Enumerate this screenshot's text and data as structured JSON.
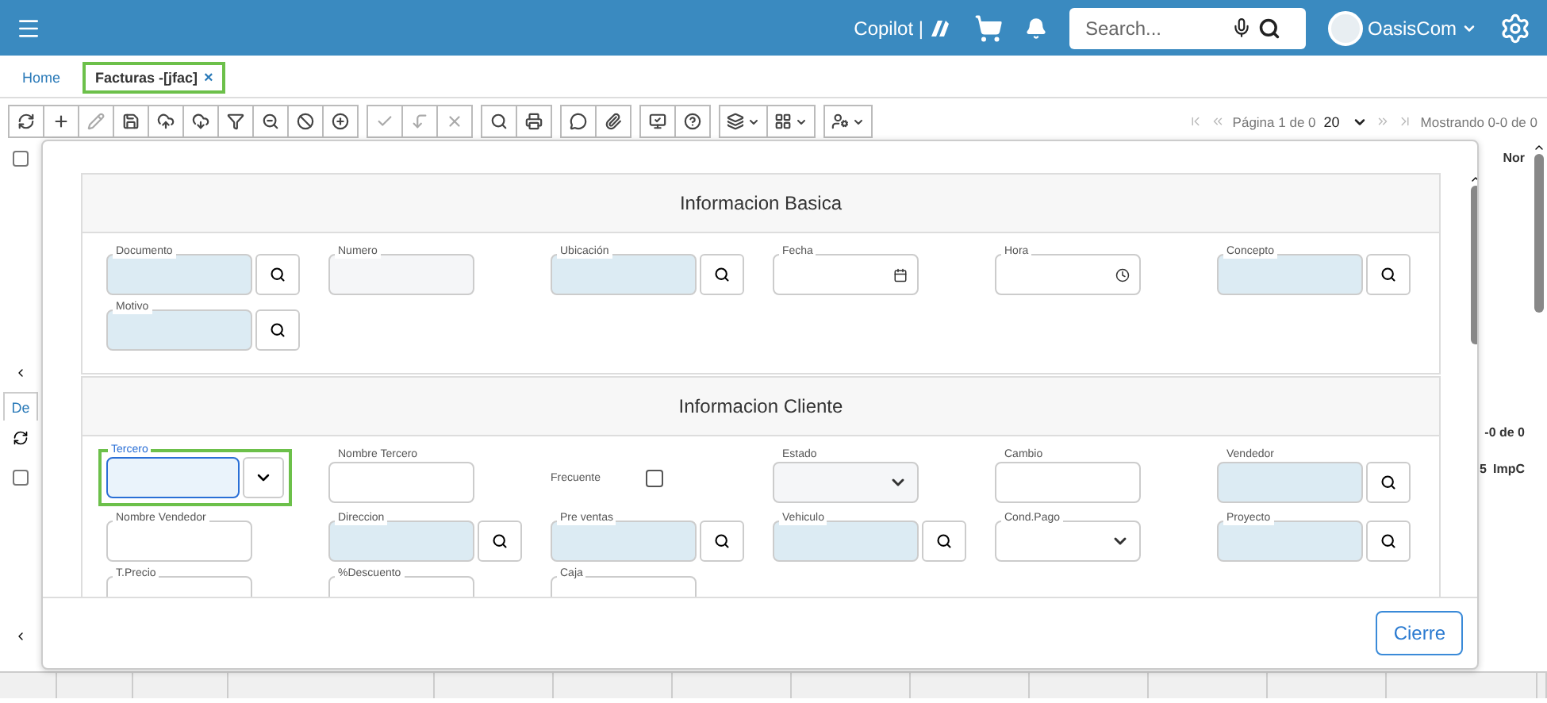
{
  "header": {
    "copilot": "Copilot |",
    "search": {
      "placeholder": "Search..."
    },
    "user": "OasisCom"
  },
  "tabs": [
    {
      "label": "Home",
      "selected": false
    },
    {
      "label": "Facturas -[jfac]",
      "selected": true,
      "close": "×"
    }
  ],
  "toolbar": {
    "groups": [
      [
        {
          "disabled": false,
          "caret": false
        },
        {
          "disabled": false,
          "caret": false
        },
        {
          "disabled": true,
          "caret": false
        },
        {
          "disabled": false,
          "caret": false
        },
        {
          "disabled": false,
          "caret": false
        },
        {
          "disabled": false,
          "caret": false
        },
        {
          "disabled": false,
          "caret": false
        },
        {
          "disabled": false,
          "caret": false
        },
        {
          "disabled": false,
          "caret": false
        },
        {
          "disabled": false,
          "caret": false
        }
      ],
      [
        {
          "disabled": true,
          "caret": false
        },
        {
          "disabled": true,
          "caret": false
        },
        {
          "disabled": true,
          "caret": false
        }
      ],
      [
        {
          "disabled": false,
          "caret": false
        },
        {
          "disabled": false,
          "caret": false
        }
      ],
      [
        {
          "disabled": false,
          "caret": false
        },
        {
          "disabled": false,
          "caret": false
        }
      ],
      [
        {
          "disabled": false,
          "caret": false
        },
        {
          "disabled": false,
          "caret": false
        }
      ],
      [
        {
          "disabled": false,
          "caret": true
        },
        {
          "disabled": false,
          "caret": true
        }
      ],
      [
        {
          "disabled": false,
          "caret": true
        }
      ]
    ],
    "pager": {
      "page": "Página 1 de 0",
      "page_size": "20",
      "showing": "Mostrando 0-0 de 0"
    }
  },
  "background": {
    "row_checks": [
      {
        "checked": false
      },
      {
        "checked": false
      }
    ],
    "grid_column": "Nor",
    "detail_tab": "De",
    "detail_showing": "-0 de 0",
    "detail_column": "ImpC",
    "detail_column_2": "5"
  },
  "dialog": {
    "sections": [
      {
        "title": "Informacion Basica",
        "fields": [
          {
            "label": "Documento",
            "kind": "lookup",
            "focused": false
          },
          {
            "label": "Numero",
            "kind": "readonly",
            "focused": false
          },
          {
            "label": "Ubicación",
            "kind": "lookup",
            "focused": false
          },
          {
            "label": "Fecha",
            "kind": "date",
            "focused": false
          },
          {
            "label": "Hora",
            "kind": "time",
            "focused": false
          },
          {
            "label": "Concepto",
            "kind": "lookup",
            "focused": false
          },
          {
            "label": "Motivo",
            "kind": "lookup",
            "focused": false
          }
        ]
      },
      {
        "title": "Informacion Cliente",
        "fields": [
          {
            "label": "Tercero",
            "kind": "combo",
            "focused": true
          },
          {
            "label": "Nombre Tercero",
            "kind": "text",
            "focused": false
          },
          {
            "label": "Frecuente",
            "kind": "checkbox",
            "checked": false
          },
          {
            "label": "Estado",
            "kind": "readonly-select",
            "focused": false
          },
          {
            "label": "Cambio",
            "kind": "text",
            "focused": false
          },
          {
            "label": "Vendedor",
            "kind": "lookup",
            "focused": false
          },
          {
            "label": "Nombre Vendedor",
            "kind": "text",
            "focused": false
          },
          {
            "label": "Direccion",
            "kind": "lookup",
            "focused": false
          },
          {
            "label": "Pre ventas",
            "kind": "lookup",
            "focused": false
          },
          {
            "label": "Vehiculo",
            "kind": "lookup",
            "focused": false
          },
          {
            "label": "Cond.Pago",
            "kind": "select",
            "focused": false
          },
          {
            "label": "Proyecto",
            "kind": "lookup",
            "focused": false
          },
          {
            "label": "T.Precio",
            "kind": "text",
            "focused": false
          },
          {
            "label": "%Descuento",
            "kind": "text",
            "focused": false
          },
          {
            "label": "Caja",
            "kind": "text",
            "focused": false
          }
        ]
      }
    ],
    "close_button": "Cierre"
  }
}
